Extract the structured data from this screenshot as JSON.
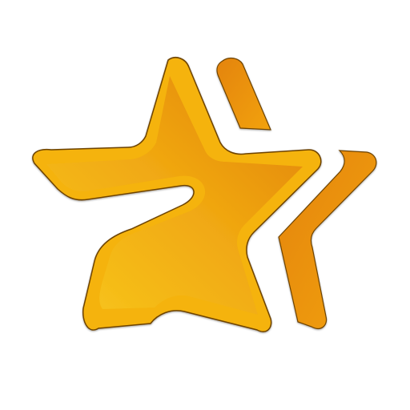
{
  "icon": {
    "name": "star-icon",
    "colors": {
      "orange_dark": "#e0800a",
      "orange_mid": "#f0a010",
      "yellow": "#f7c21b",
      "rim": "#f6b400",
      "outline": "#7a4a00"
    }
  }
}
